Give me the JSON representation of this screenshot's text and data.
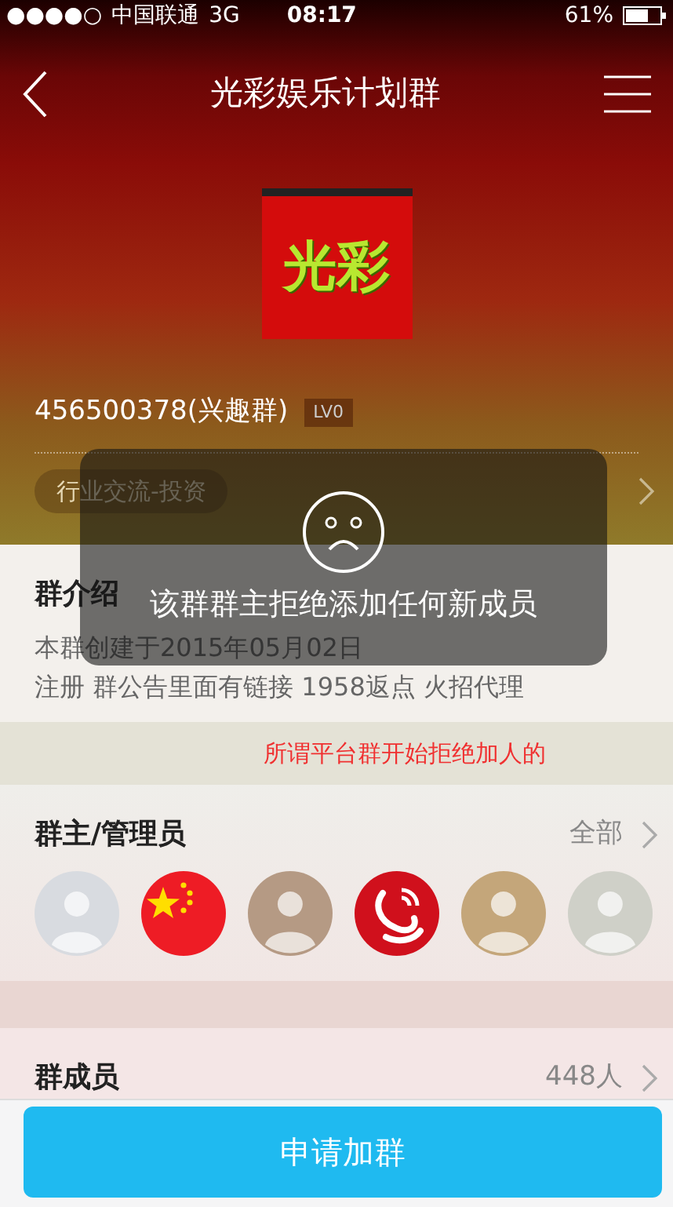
{
  "status_bar": {
    "signal": "●●●●○",
    "carrier": "中国联通",
    "network": "3G",
    "time": "08:17",
    "battery": "61%"
  },
  "nav": {
    "title": "光彩娱乐计划群"
  },
  "group": {
    "logo_text": "光彩",
    "id_line": "456500378(兴趣群)",
    "level": "LV0",
    "tag": "行业交流-投资"
  },
  "intro": {
    "title": "群介绍",
    "lines": [
      "本群创建于2015年05月02日",
      "注册 群公告里面有链接 1958返点 火招代理"
    ]
  },
  "annotation": "所谓平台群开始拒绝加人的",
  "admins": {
    "title": "群主/管理员",
    "more": "全部",
    "avatars": [
      {
        "kind": "photo"
      },
      {
        "kind": "flag"
      },
      {
        "kind": "photo"
      },
      {
        "kind": "logo"
      },
      {
        "kind": "photo"
      },
      {
        "kind": "photo"
      }
    ]
  },
  "members": {
    "title": "群成员",
    "count": "448人"
  },
  "toast": {
    "message": "该群群主拒绝添加任何新成员"
  },
  "join_button": "申请加群"
}
